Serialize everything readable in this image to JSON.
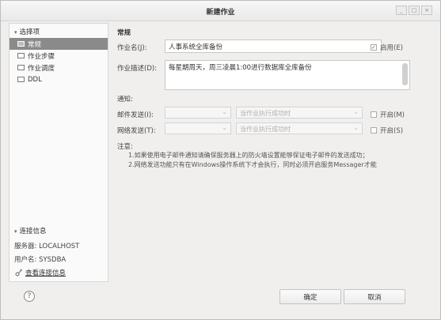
{
  "window": {
    "title": "新建作业",
    "controls": [
      "_",
      "□",
      "×"
    ]
  },
  "sidebar": {
    "section_options": "选择项",
    "items": [
      {
        "label": "常规",
        "selected": true
      },
      {
        "label": "作业步骤",
        "selected": false
      },
      {
        "label": "作业调度",
        "selected": false
      },
      {
        "label": "DDL",
        "selected": false
      }
    ],
    "section_connection": "连接信息",
    "server": "服务器: LOCALHOST",
    "user": "用户名: SYSDBA",
    "view_connection": "查看连接信息"
  },
  "general": {
    "section_title": "常规",
    "job_name_label": "作业名(J):",
    "job_name_value": "人事系统全库备份",
    "enable_label": "启用(E)",
    "enable_checked": true,
    "job_desc_label": "作业描述(D):",
    "job_desc_value": "每星期周天，周三凌晨1:00进行数据库全库备份",
    "notify_label": "通知:",
    "mail_label": "邮件发送(I):",
    "mail_condition": "当作业执行成功时",
    "mail_toggle_label": "开启(M)",
    "net_label": "网络发送(T):",
    "net_condition": "当作业执行成功时",
    "net_toggle_label": "开启(S)",
    "notes_label": "注意:",
    "notes": [
      "1.如果使用电子邮件通知请确保服务器上的防火墙设置能够保证电子邮件的发送成功；",
      "2.网络发送功能只有在Windows操作系统下才会执行，同时必须开启服务Messager才能"
    ]
  },
  "footer": {
    "help_glyph": "?",
    "ok_label": "确定",
    "cancel_label": "取消"
  }
}
